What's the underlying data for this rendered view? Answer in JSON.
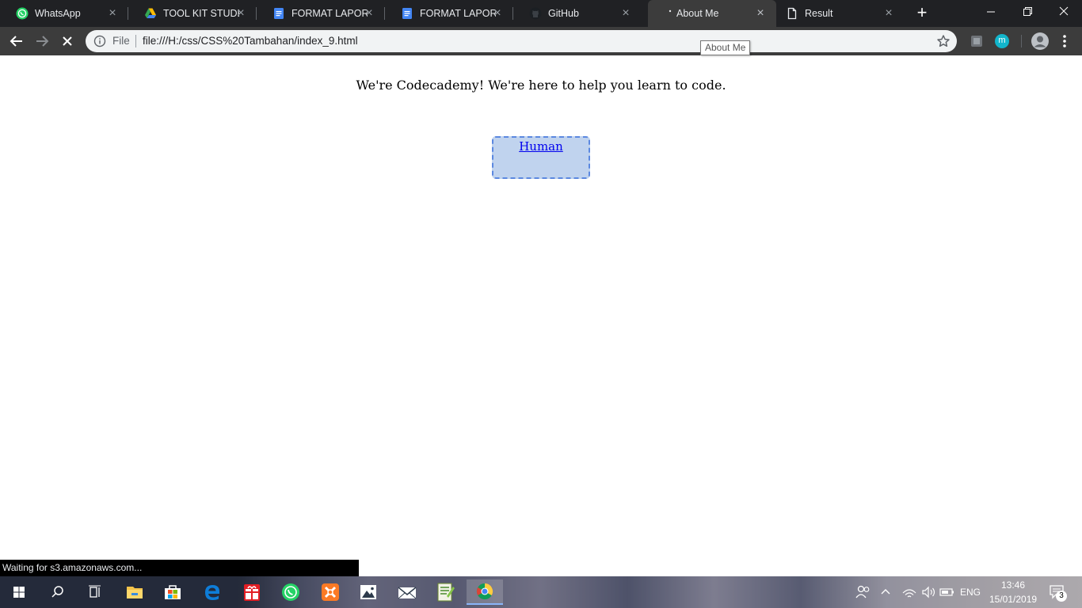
{
  "tabs": [
    {
      "title": "WhatsApp",
      "icon": "whatsapp-icon",
      "active": false
    },
    {
      "title": "TOOL KIT STUDENT",
      "icon": "google-drive-icon",
      "active": false
    },
    {
      "title": "FORMAT LAPORAN",
      "icon": "google-docs-icon",
      "active": false
    },
    {
      "title": "FORMAT LAPORAN",
      "icon": "google-docs-icon",
      "active": false
    },
    {
      "title": "GitHub",
      "icon": "github-icon",
      "active": false
    },
    {
      "title": "About Me",
      "icon": "loading-icon",
      "active": true
    },
    {
      "title": "Result",
      "icon": "page-icon",
      "active": false
    }
  ],
  "toolbar": {
    "scheme_label": "File",
    "url": "file:///H:/css/CSS%20Tambahan/index_9.html",
    "tooltip": "About Me",
    "profile_ext_letter": "m"
  },
  "page": {
    "intro": "We're Codecademy! We're here to help you learn to code.",
    "link_text": "Human"
  },
  "status": {
    "text": "Waiting for s3.amazonaws.com..."
  },
  "taskbar": {
    "apps": [
      "windows-start-icon",
      "search-icon",
      "task-view-icon",
      "file-explorer-icon",
      "microsoft-store-icon",
      "edge-icon",
      "gift-icon",
      "whatsapp-icon",
      "xampp-icon",
      "photos-icon",
      "mail-icon",
      "notepad-plus-icon",
      "chrome-icon"
    ],
    "language": "ENG",
    "time": "13:46",
    "date": "15/01/2019",
    "notification_count": "3"
  },
  "colors": {
    "tabstrip": "#202124",
    "toolbar": "#3c3c3c",
    "box_fill": "#c0d3ee",
    "box_border": "#5b88e0",
    "link": "#0000ee"
  }
}
